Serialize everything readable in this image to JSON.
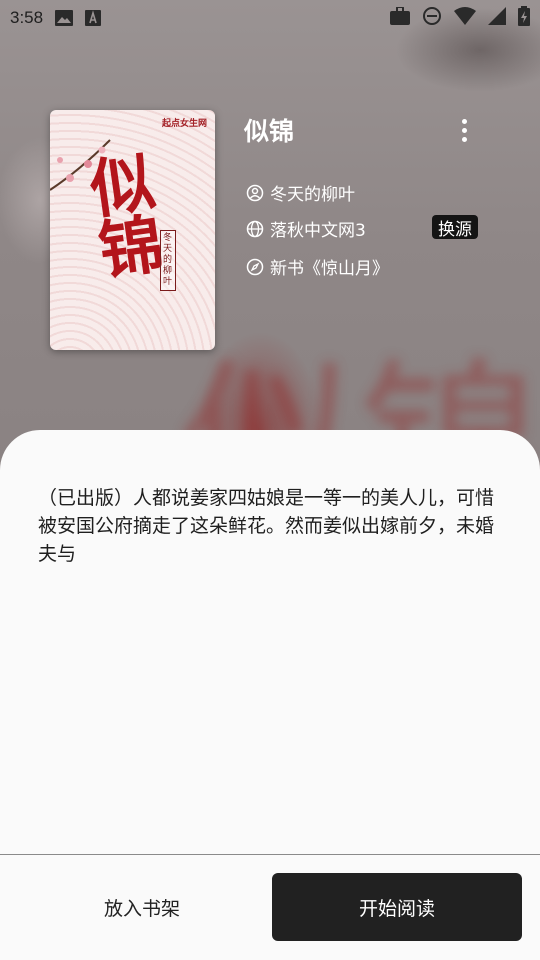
{
  "status_bar": {
    "time": "3:58",
    "icons": [
      "image-icon",
      "a-box-icon",
      "briefcase-icon",
      "do-not-disturb-icon",
      "wifi-icon",
      "signal-icon",
      "battery-icon"
    ]
  },
  "book": {
    "title": "似锦",
    "author": "冬天的柳叶",
    "source": "落秋中文网3",
    "switch_source_label": "换源",
    "latest_chapter": "新书《惊山月》",
    "cover": {
      "title_text": "似锦",
      "author_text": "冬天的柳叶",
      "logo_text": "起点女生网"
    },
    "intro": "（已出版）人都说姜家四姑娘是一等一的美人儿，可惜被安国公府摘走了这朵鲜花。然而姜似出嫁前夕，未婚夫与"
  },
  "actions": {
    "add_to_shelf": "放入书架",
    "start_reading": "开始阅读"
  },
  "colors": {
    "primary_button": "#212121",
    "sheet_background": "#fafafa",
    "cover_title": "#b3151b"
  }
}
